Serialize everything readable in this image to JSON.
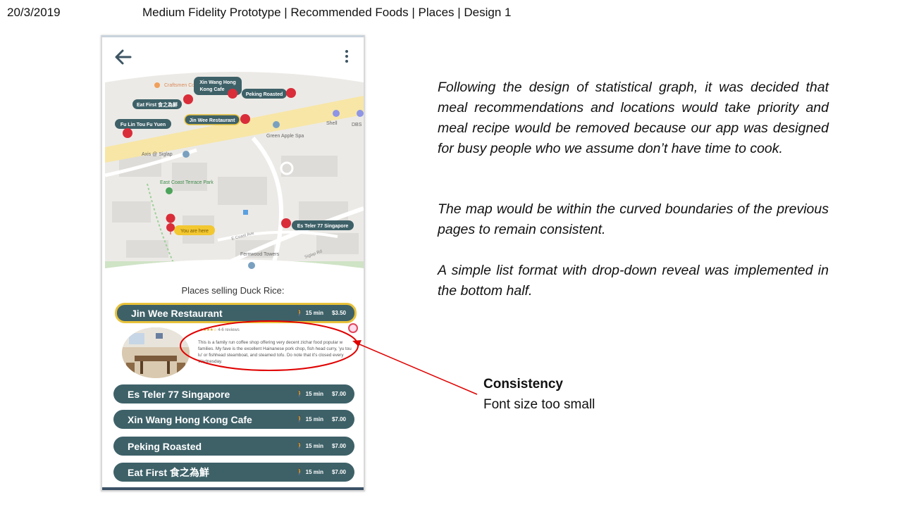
{
  "slide": {
    "date": "20/3/2019",
    "title": "Medium Fidelity Prototype | Recommended Foods | Places | Design 1"
  },
  "map": {
    "labels": {
      "craftsmen": "Craftsmen Coffee (Si",
      "shell": "Shell",
      "dbs": "DBS",
      "green_apple": "Green Apple Spa",
      "axis": "Axis @ Siglap",
      "park": "East Coast Terrace Park",
      "you_are_here": "You are here",
      "fernwood": "Fernwood Towers",
      "e_coast_ave": "E Coast Ave",
      "siglap_rd": "Siglap Rd"
    },
    "markers": {
      "xin_wang_1": "Xin Wang Hong",
      "xin_wang_2": "Kong Cafe",
      "peking": "Peking Roasted",
      "eat_first": "Eat First 食之為鮮",
      "fu_lin": "Fu Lin Tou Fu Yuen",
      "jin_wee": "Jin Wee Restaurant",
      "es_teler": "Es Teler 77 Singapore"
    }
  },
  "list": {
    "heading": "Places selling Duck Rice:",
    "places": [
      {
        "name": "Jin Wee Restaurant",
        "time": "15 min",
        "price": "$3.50"
      },
      {
        "name": "Es Teler 77 Singapore",
        "time": "15 min",
        "price": "$7.00"
      },
      {
        "name": "Xin Wang Hong Kong Cafe",
        "time": "15 min",
        "price": "$7.00"
      },
      {
        "name": "Peking Roasted",
        "time": "15 min",
        "price": "$7.00"
      },
      {
        "name": "Eat First 食之為鮮",
        "time": "15 min",
        "price": "$7.00"
      }
    ],
    "detail": {
      "stars": "★★★★☆",
      "reviews": "4-6 reviews",
      "text": "This is a family run coffee shop offering very decent zichar food popular w families. My fave is the excellent Hainanese pork chop, fish head curry, 'yu tou lu' or fishhead steamboat, and steamed tofu. Do note that it's closed every Wednesday."
    }
  },
  "annotation": {
    "heading": "Consistency",
    "body": "Font size too small",
    "color": "#e00000"
  },
  "description": {
    "p1": "Following the design of statistical graph, it was decided that meal recommendations and locations would take priority and meal recipe would be removed because our app was designed for busy people who we assume don’t have time to cook.",
    "p2": "The map would be within the curved boundaries of the previous pages to remain consistent.",
    "p3": "A simple list format with drop-down reveal was implemented in the bottom half."
  },
  "colors": {
    "list_bar": "#3e6168",
    "selected_border": "#e8c23a",
    "marker_red": "#d92d3a"
  }
}
